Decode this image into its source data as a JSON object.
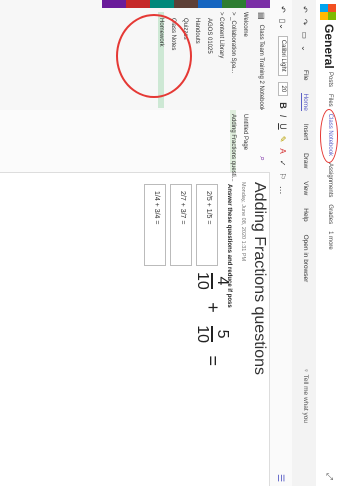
{
  "title": "General",
  "colors": {
    "accent": "#5b5fc7",
    "annotation": "#e53935",
    "active_section": "#cde8d4"
  },
  "channel_tabs": [
    "Posts",
    "Files",
    "Class Notebook",
    "Assignments",
    "Grades",
    "1 more"
  ],
  "ribbon": {
    "icons": [
      "undo-icon",
      "redo-icon",
      "notebook-icon",
      "dropdown-icon"
    ],
    "menu": [
      "File",
      "Home",
      "Insert",
      "Draw",
      "View",
      "Help",
      "Open in browser"
    ],
    "selected_menu": "Home",
    "tell_me": "Tell me what you"
  },
  "format": {
    "font": "Calibri Light",
    "size": "20",
    "bold": "B",
    "italic": "I",
    "underline": "U"
  },
  "notebook": {
    "header": "Class Team Training 2 Notebook",
    "sections": [
      {
        "label": "Welcome",
        "type": "top"
      },
      {
        "label": "> _Collaboration Spa...",
        "type": "top"
      },
      {
        "label": "> Content Library",
        "type": "top"
      },
      {
        "label": "AGOS 01025",
        "type": "child"
      },
      {
        "label": "Handouts",
        "type": "child"
      },
      {
        "label": "Quizzes",
        "type": "child"
      },
      {
        "label": "Class Notes",
        "type": "child"
      },
      {
        "label": "Homework",
        "type": "active"
      }
    ],
    "tab_colors": [
      "#7b2ea6",
      "#2e7d32",
      "#1565c0",
      "#5d4037",
      "#00897b",
      "#c62828",
      "#6a1b9a"
    ]
  },
  "pages": {
    "items": [
      "Untitled Page",
      "Adding Fractions questi..."
    ],
    "active_index": 1
  },
  "page": {
    "title": "Adding Fractions questions",
    "date": "Monday, June 08, 2020   1:31 PM",
    "instructions": "Answer these questions and reduce if poss",
    "problems": [
      "2/5 + 1/5 =",
      "2/7 + 3/7 =",
      "1/4 + 3/4 ="
    ],
    "big_problem": {
      "n1": "4",
      "d1": "10",
      "op": "+",
      "n2": "5",
      "d2": "10",
      "eq": "="
    }
  }
}
